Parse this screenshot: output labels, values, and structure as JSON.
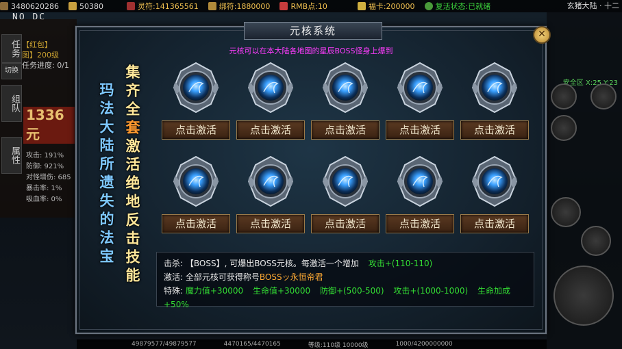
{
  "hud": {
    "gold1": "3480620286",
    "gold2": "50380",
    "lingfu_label": "灵符:",
    "lingfu": "141365561",
    "yuanbao_label": "绑符:",
    "yuanbao": "1880000",
    "rmb_label": "RMB点:",
    "rmb": "10",
    "card_label": "福卡:",
    "card": "200000",
    "revive_label": "复活状态:",
    "revive": "已就绪",
    "zone": "玄猪大陆 · 十二",
    "nodc": "NO DC",
    "task_tab": "任务",
    "switch_btn": "切换",
    "team_tab": "组队",
    "attr_tab": "属性",
    "task_line1": "【红包】",
    "task_line2": "图】200级",
    "task_progress": "任务进度: 0/1",
    "level_text": "1336 元",
    "stats": [
      "攻击: 191%",
      "防御: 921%",
      "对怪增伤: 685",
      "暴击率: 1%",
      "吸血率: 0%"
    ],
    "safe_zone": "安全区 X:25 Y:23",
    "bottom_a": "49879577/49879577",
    "bottom_b": "4470165/4470165",
    "bottom_c": "等级:110级 10000级",
    "bottom_d": "1000/4200000000"
  },
  "dialog": {
    "title": "元核系统",
    "subtitle": "元核可以在本大陆各地图的星辰BOSS怪身上爆到",
    "left_text": "玛法大陆所遗失的法宝",
    "right_text_a": "集齐全",
    "right_text_hl": "套",
    "right_text_b": "激活绝地反击技能",
    "slots": [
      {
        "label": "点击激活"
      },
      {
        "label": "点击激活"
      },
      {
        "label": "点击激活"
      },
      {
        "label": "点击激活"
      },
      {
        "label": "点击激活"
      },
      {
        "label": "点击激活"
      },
      {
        "label": "点击激活"
      },
      {
        "label": "点击激活"
      },
      {
        "label": "点击激活"
      },
      {
        "label": "点击激活"
      }
    ],
    "info": {
      "kill_label": "击杀:",
      "kill_text": "【BOSS】, 可爆出BOSS元核。每激活一个增加",
      "kill_bonus": "攻击+(110-110)",
      "act_label": "激活:",
      "act_text": "全部元核可获得称号",
      "act_title": "BOSSッ永恒帝君",
      "sp_label": "特殊:",
      "sp1": "魔力值+30000",
      "sp2": "生命值+30000",
      "sp3": "防御+(500-500)",
      "sp4": "攻击+(1000-1000)",
      "sp5": "生命加成+50%"
    }
  },
  "colors": {
    "accent_gold": "#f0c050",
    "highlight_green": "#33dd33",
    "subtitle_magenta": "#ff3cff",
    "button_brown": "#5b3a22",
    "emblem_blue": "#3aa0ff"
  }
}
